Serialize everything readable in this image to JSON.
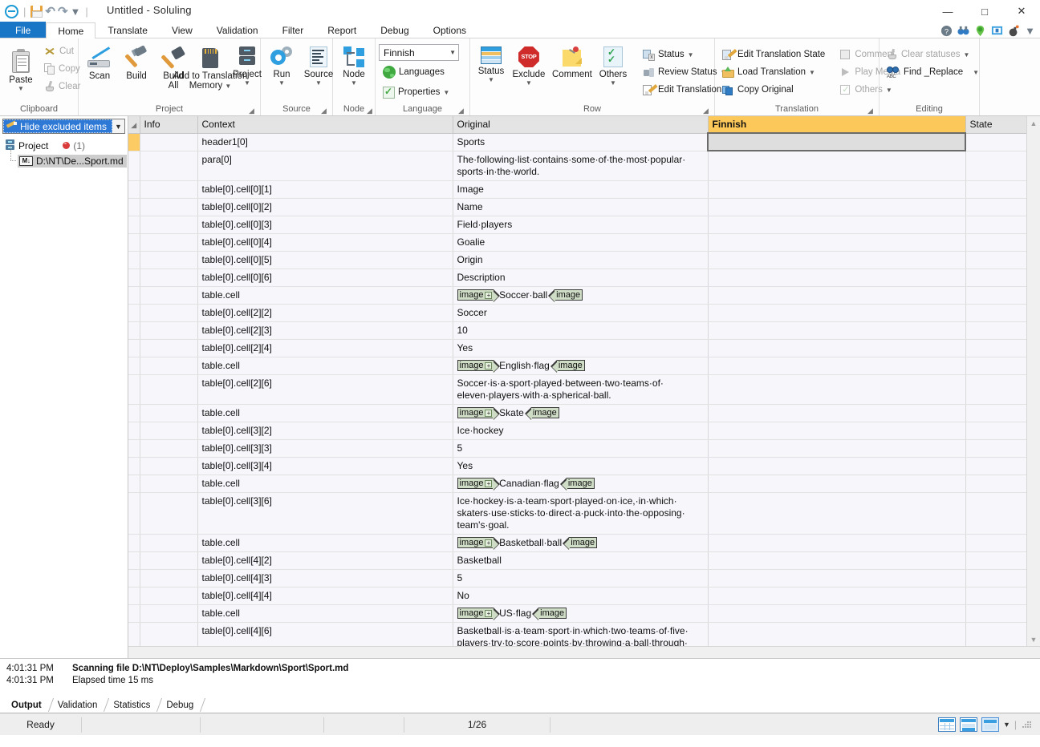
{
  "window": {
    "title": "Untitled  -  Soluling",
    "minimize": "—",
    "maximize": "□",
    "close": "✕"
  },
  "quick_access": {
    "save": "save-icon",
    "undo": "undo-icon",
    "redo": "redo-icon",
    "more": "customize-quick-access-icon"
  },
  "ribbon": {
    "tabs": [
      {
        "label": "File",
        "active": false,
        "file": true
      },
      {
        "label": "Home",
        "active": true
      },
      {
        "label": "Translate",
        "active": false
      },
      {
        "label": "View",
        "active": false
      },
      {
        "label": "Validation",
        "active": false
      },
      {
        "label": "Filter",
        "active": false
      },
      {
        "label": "Report",
        "active": false
      },
      {
        "label": "Debug",
        "active": false
      },
      {
        "label": "Options",
        "active": false
      }
    ],
    "right_icons": [
      "help-icon",
      "binoculars-icon",
      "globe-pin-icon",
      "monitor-icon",
      "bomb-icon",
      "chevron-down-icon"
    ],
    "groups": {
      "clipboard": {
        "label": "Clipboard",
        "paste": "Paste",
        "cut": "Cut",
        "copy": "Copy",
        "clear": "Clear"
      },
      "project": {
        "label": "Project",
        "scan": "Scan",
        "build": "Build",
        "build_all_1": "Build",
        "build_all_2": "All",
        "add_tm_1": "Add to Translation",
        "add_tm_2": "Memory",
        "project": "Project"
      },
      "source": {
        "label": "Source",
        "run": "Run",
        "source": "Source"
      },
      "node": {
        "label": "Node",
        "node": "Node"
      },
      "language": {
        "label": "Language",
        "selected": "Finnish",
        "languages": "Languages",
        "properties": "Properties"
      },
      "row": {
        "label": "Row",
        "status": "Status",
        "exclude": "Exclude",
        "stop_text": "STOP",
        "comment": "Comment",
        "others": "Others",
        "status_menu": "Status",
        "review_status": "Review Status",
        "edit_translation": "Edit Translation"
      },
      "translation": {
        "label": "Translation",
        "edit_translation_state": "Edit Translation State",
        "load_translation": "Load Translation",
        "copy_original": "Copy Original",
        "comment": "Comment",
        "play_media": "Play Media",
        "others": "Others"
      },
      "editing": {
        "label": "Editing",
        "clear_statuses": "Clear statuses",
        "find_replace": "Find _Replace",
        "abc": "ABC"
      }
    }
  },
  "left_pane": {
    "filter_label": "Hide excluded items",
    "tree": {
      "project_label": "Project",
      "project_count": "(1)",
      "file_label": "D:\\NT\\De...Sport.md",
      "file_badge": "M↓"
    }
  },
  "grid": {
    "columns": [
      "Info",
      "Context",
      "Original",
      "Finnish",
      "State"
    ],
    "selected_column": "Finnish",
    "rows": [
      {
        "selected": true,
        "context": "header1[0]",
        "original": [
          {
            "t": "text",
            "v": "Sports"
          }
        ]
      },
      {
        "selected": false,
        "context": "para[0]",
        "original": [
          {
            "t": "text",
            "v": "The·following·list·contains·some·of·the·most·popular·\nsports·in·the·world."
          }
        ]
      },
      {
        "selected": false,
        "context": "table[0].cell[0][1]",
        "original": [
          {
            "t": "text",
            "v": "Image"
          }
        ]
      },
      {
        "selected": false,
        "context": "table[0].cell[0][2]",
        "original": [
          {
            "t": "text",
            "v": "Name"
          }
        ]
      },
      {
        "selected": false,
        "context": "table[0].cell[0][3]",
        "original": [
          {
            "t": "text",
            "v": "Field·players"
          }
        ]
      },
      {
        "selected": false,
        "context": "table[0].cell[0][4]",
        "original": [
          {
            "t": "text",
            "v": "Goalie"
          }
        ]
      },
      {
        "selected": false,
        "context": "table[0].cell[0][5]",
        "original": [
          {
            "t": "text",
            "v": "Origin"
          }
        ]
      },
      {
        "selected": false,
        "context": "table[0].cell[0][6]",
        "original": [
          {
            "t": "text",
            "v": "Description"
          }
        ]
      },
      {
        "selected": false,
        "context": "table.cell",
        "original": [
          {
            "t": "tag-open",
            "v": "image"
          },
          {
            "t": "text",
            "v": "Soccer·ball"
          },
          {
            "t": "tag-close",
            "v": "image"
          }
        ]
      },
      {
        "selected": false,
        "context": "table[0].cell[2][2]",
        "original": [
          {
            "t": "text",
            "v": "Soccer"
          }
        ]
      },
      {
        "selected": false,
        "context": "table[0].cell[2][3]",
        "original": [
          {
            "t": "text",
            "v": "10"
          }
        ]
      },
      {
        "selected": false,
        "context": "table[0].cell[2][4]",
        "original": [
          {
            "t": "text",
            "v": "Yes"
          }
        ]
      },
      {
        "selected": false,
        "context": "table.cell",
        "original": [
          {
            "t": "tag-open",
            "v": "image"
          },
          {
            "t": "text",
            "v": "English·flag"
          },
          {
            "t": "tag-close",
            "v": "image"
          }
        ]
      },
      {
        "selected": false,
        "context": "table[0].cell[2][6]",
        "original": [
          {
            "t": "text",
            "v": "Soccer·is·a·sport·played·between·two·teams·of·\neleven·players·with·a·spherical·ball."
          }
        ]
      },
      {
        "selected": false,
        "context": "table.cell",
        "original": [
          {
            "t": "tag-open",
            "v": "image"
          },
          {
            "t": "text",
            "v": "Skate"
          },
          {
            "t": "tag-close",
            "v": "image"
          }
        ]
      },
      {
        "selected": false,
        "context": "table[0].cell[3][2]",
        "original": [
          {
            "t": "text",
            "v": "Ice·hockey"
          }
        ]
      },
      {
        "selected": false,
        "context": "table[0].cell[3][3]",
        "original": [
          {
            "t": "text",
            "v": "5"
          }
        ]
      },
      {
        "selected": false,
        "context": "table[0].cell[3][4]",
        "original": [
          {
            "t": "text",
            "v": "Yes"
          }
        ]
      },
      {
        "selected": false,
        "context": "table.cell",
        "original": [
          {
            "t": "tag-open",
            "v": "image"
          },
          {
            "t": "text",
            "v": "Canadian·flag"
          },
          {
            "t": "tag-close",
            "v": "image"
          }
        ]
      },
      {
        "selected": false,
        "context": "table[0].cell[3][6]",
        "original": [
          {
            "t": "text",
            "v": "Ice·hockey·is·a·team·sport·played·on·ice,·in·which·\nskaters·use·sticks·to·direct·a·puck·into·the·opposing·\nteam's·goal."
          }
        ]
      },
      {
        "selected": false,
        "context": "table.cell",
        "original": [
          {
            "t": "tag-open",
            "v": "image"
          },
          {
            "t": "text",
            "v": "Basketball·ball"
          },
          {
            "t": "tag-close",
            "v": "image"
          }
        ]
      },
      {
        "selected": false,
        "context": "table[0].cell[4][2]",
        "original": [
          {
            "t": "text",
            "v": "Basketball"
          }
        ]
      },
      {
        "selected": false,
        "context": "table[0].cell[4][3]",
        "original": [
          {
            "t": "text",
            "v": "5"
          }
        ]
      },
      {
        "selected": false,
        "context": "table[0].cell[4][4]",
        "original": [
          {
            "t": "text",
            "v": "No"
          }
        ]
      },
      {
        "selected": false,
        "context": "table.cell",
        "original": [
          {
            "t": "tag-open",
            "v": "image"
          },
          {
            "t": "text",
            "v": "US·flag"
          },
          {
            "t": "tag-close",
            "v": "image"
          }
        ]
      },
      {
        "selected": false,
        "context": "table[0].cell[4][6]",
        "original": [
          {
            "t": "text",
            "v": "Basketball·is·a·team·sport·in·which·two·teams·of·five·\nplayers·try·to·score·points·by·throwing·a·ball·through·\nthe·top·of·a·basketball·hoop·while·following·a·set·of·\nrules."
          }
        ]
      }
    ]
  },
  "output": {
    "lines": [
      {
        "time": "4:01:31 PM",
        "text": "Scanning file D:\\NT\\Deploy\\Samples\\Markdown\\Sport\\Sport.md",
        "bold": true
      },
      {
        "time": "4:01:31 PM",
        "text": "Elapsed time 15 ms",
        "bold": false
      }
    ],
    "tabs": [
      {
        "label": "Output",
        "active": true
      },
      {
        "label": "Validation",
        "active": false
      },
      {
        "label": "Statistics",
        "active": false
      },
      {
        "label": "Debug",
        "active": false
      }
    ]
  },
  "statusbar": {
    "ready": "Ready",
    "count": "1/26",
    "view_modes": [
      "grid-view-icon",
      "split-view-icon",
      "form-view-icon",
      "view-options-caret-icon"
    ]
  }
}
